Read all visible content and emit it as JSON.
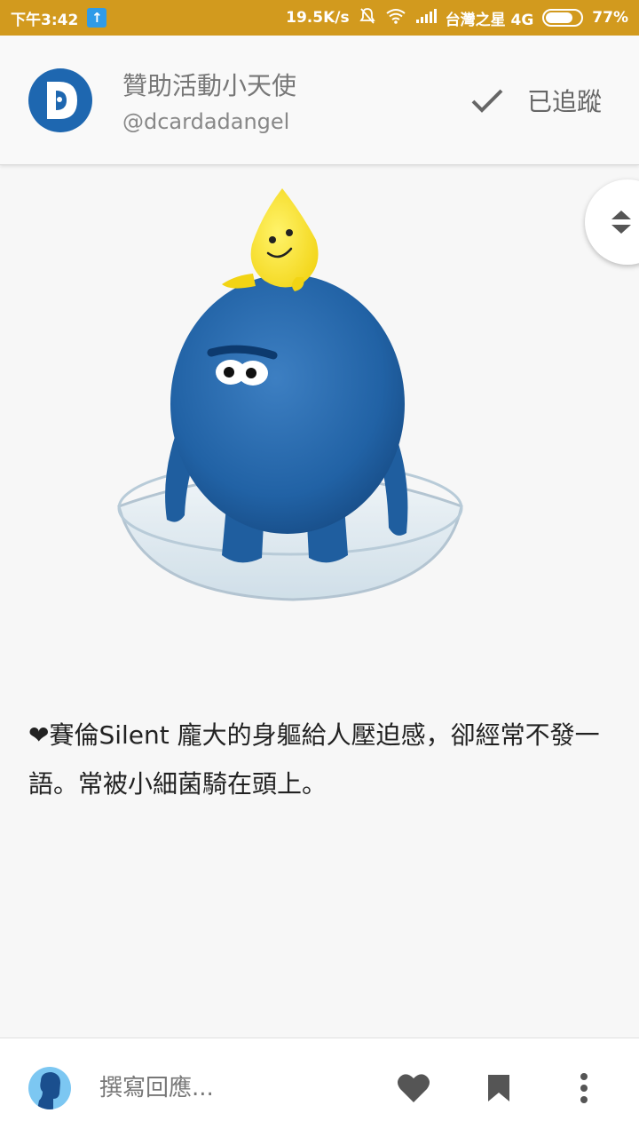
{
  "status_bar": {
    "time": "下午3:42",
    "network_speed": "19.5K/s",
    "carrier": "台灣之星 4G",
    "battery": "77%",
    "battery_level": 0.77,
    "upload_icon": "upload-arrow-icon",
    "color": "#d29a1e"
  },
  "header": {
    "title": "贊助活動小天使",
    "handle": "@dcardadangel",
    "follow_label": "已追蹤",
    "avatar_color": "#1e67b0"
  },
  "post": {
    "heart": "❤",
    "text": "賽倫Silent 龐大的身軀給人壓迫感，卻經常不發一語。常被小細菌騎在頭上。"
  },
  "bottom_bar": {
    "reply_placeholder": "撰寫回應...",
    "like_icon": "heart-icon",
    "bookmark_icon": "bookmark-icon",
    "more_icon": "more-vertical-icon"
  }
}
